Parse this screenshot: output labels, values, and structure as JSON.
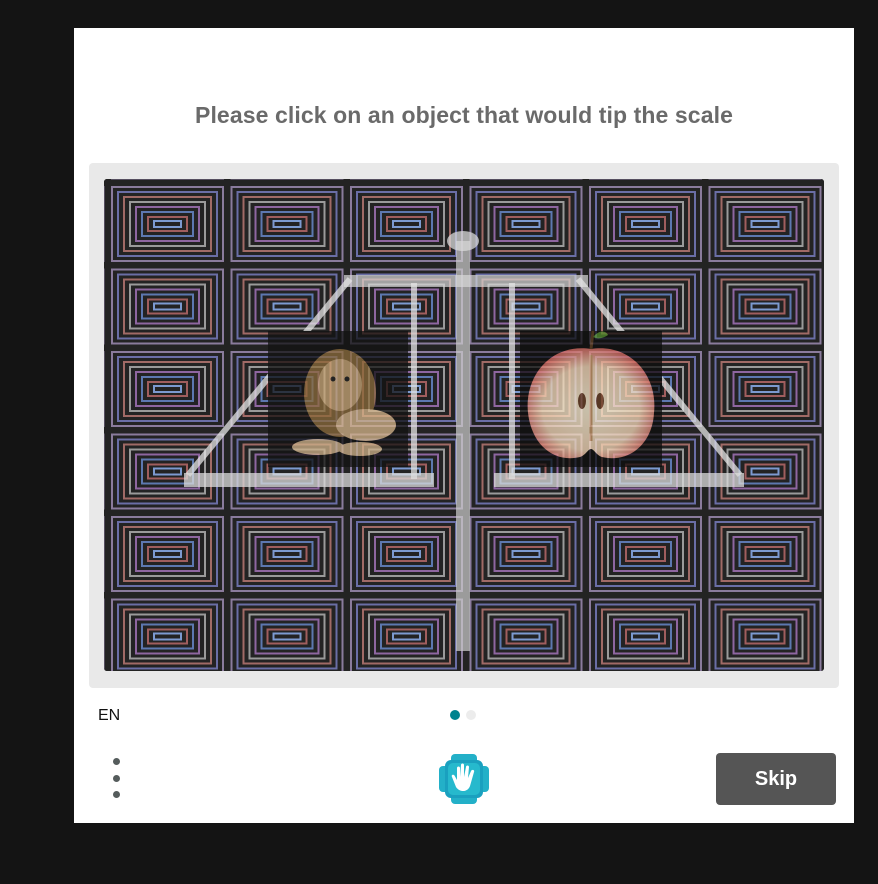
{
  "prompt": {
    "text": "Please click on an object that would tip the scale"
  },
  "challenge": {
    "left_object": "lion",
    "right_object": "apple",
    "scene": "balance-scale",
    "background_pattern": "concentric-squares"
  },
  "footer": {
    "language": "EN",
    "page_count": 2,
    "active_page": 1,
    "skip_label": "Skip"
  },
  "colors": {
    "accent": "#00838f",
    "skip_button": "#555555",
    "prompt_text": "#6a6a6a"
  }
}
